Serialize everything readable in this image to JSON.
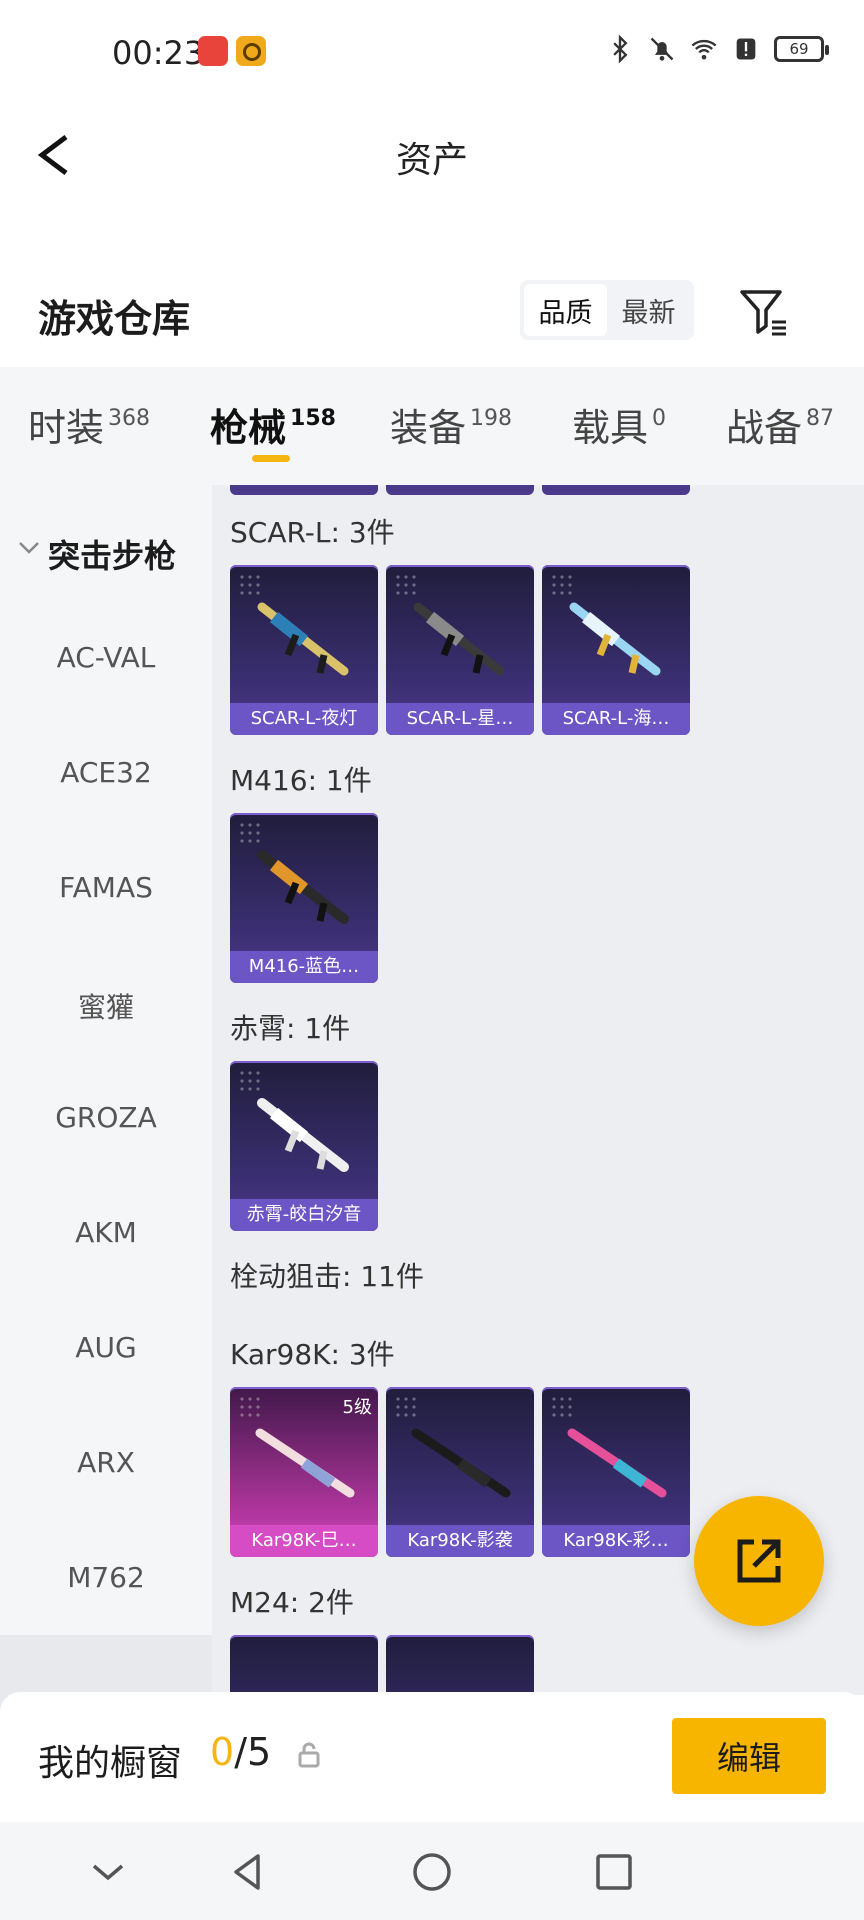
{
  "status_bar": {
    "time": "00:23",
    "battery": "69",
    "icons": [
      "bluetooth-icon",
      "mute-icon",
      "wifi-icon",
      "alert-icon",
      "battery-icon"
    ]
  },
  "header": {
    "title": "资产",
    "back_icon": "chevron-left-icon"
  },
  "warehouse": {
    "title": "游戏仓库",
    "sort_options": [
      "品质",
      "最新"
    ],
    "active_sort": "品质",
    "filter_icon": "filter-icon"
  },
  "tabs": [
    {
      "label": "时装",
      "count": "368"
    },
    {
      "label": "枪械",
      "count": "158"
    },
    {
      "label": "装备",
      "count": "198"
    },
    {
      "label": "载具",
      "count": "0"
    },
    {
      "label": "战备",
      "count": "87"
    }
  ],
  "active_tab": "枪械",
  "sidebar": {
    "section_label": "突击步枪",
    "items": [
      "AC-VAL",
      "ACE32",
      "FAMAS",
      "蜜獾",
      "GROZA",
      "AKM",
      "AUG",
      "ARX",
      "M762"
    ]
  },
  "content": {
    "groups": [
      {
        "title": "SCAR-L: 3件",
        "cards": [
          {
            "label": "SCAR-L-夜灯",
            "tier": "epic"
          },
          {
            "label": "SCAR-L-星…",
            "tier": "epic"
          },
          {
            "label": "SCAR-L-海…",
            "tier": "epic"
          }
        ]
      },
      {
        "title": "M416: 1件",
        "cards": [
          {
            "label": "M416-蓝色…",
            "tier": "epic"
          }
        ]
      },
      {
        "title": "赤霄: 1件",
        "cards": [
          {
            "label": "赤霄-皎白汐音",
            "tier": "epic"
          }
        ]
      },
      {
        "title": "栓动狙击: 11件",
        "cards": []
      },
      {
        "title": "Kar98K: 3件",
        "cards": [
          {
            "label": "Kar98K-巳…",
            "tier": "legend",
            "level": "5级"
          },
          {
            "label": "Kar98K-影袭",
            "tier": "epic"
          },
          {
            "label": "Kar98K-彩…",
            "tier": "epic"
          }
        ]
      },
      {
        "title": "M24: 2件",
        "cards": []
      }
    ]
  },
  "showcase": {
    "title": "我的橱窗",
    "current": "0",
    "total": "/5",
    "edit_label": "编辑"
  },
  "colors": {
    "accent": "#f7b500",
    "epic_card": "#6c55c4",
    "legend_card": "#d64cc4"
  }
}
